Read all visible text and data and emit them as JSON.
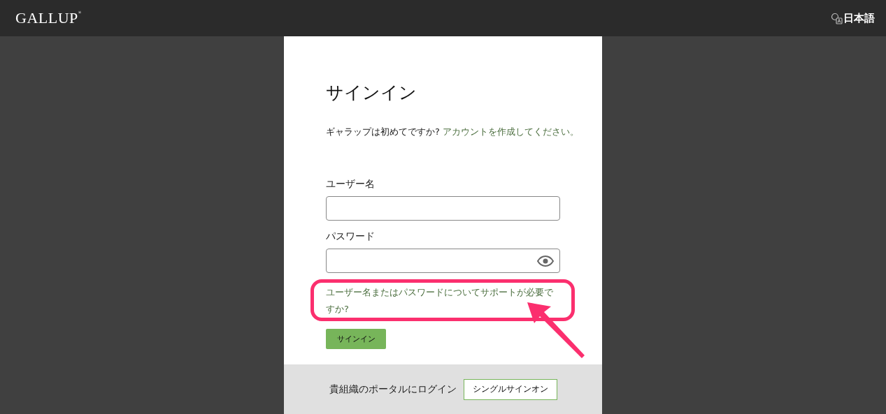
{
  "header": {
    "logo": "GALLUP",
    "logo_mark": "®",
    "language": "日本語"
  },
  "signin": {
    "title": "サインイン",
    "intro": "ギャラップは初めてですか?",
    "create_account_link": "アカウントを作成してください。",
    "fields": [
      {
        "label": "ユーザー名",
        "kind": "text"
      },
      {
        "label": "パスワード",
        "kind": "password"
      }
    ],
    "help_link": "ユーザー名またはパスワードについてサポートが必要ですか?",
    "submit_button": "サインイン"
  },
  "footer": {
    "text": "貴組織のポータルにログイン",
    "sso_button": "シングルサインオン"
  }
}
